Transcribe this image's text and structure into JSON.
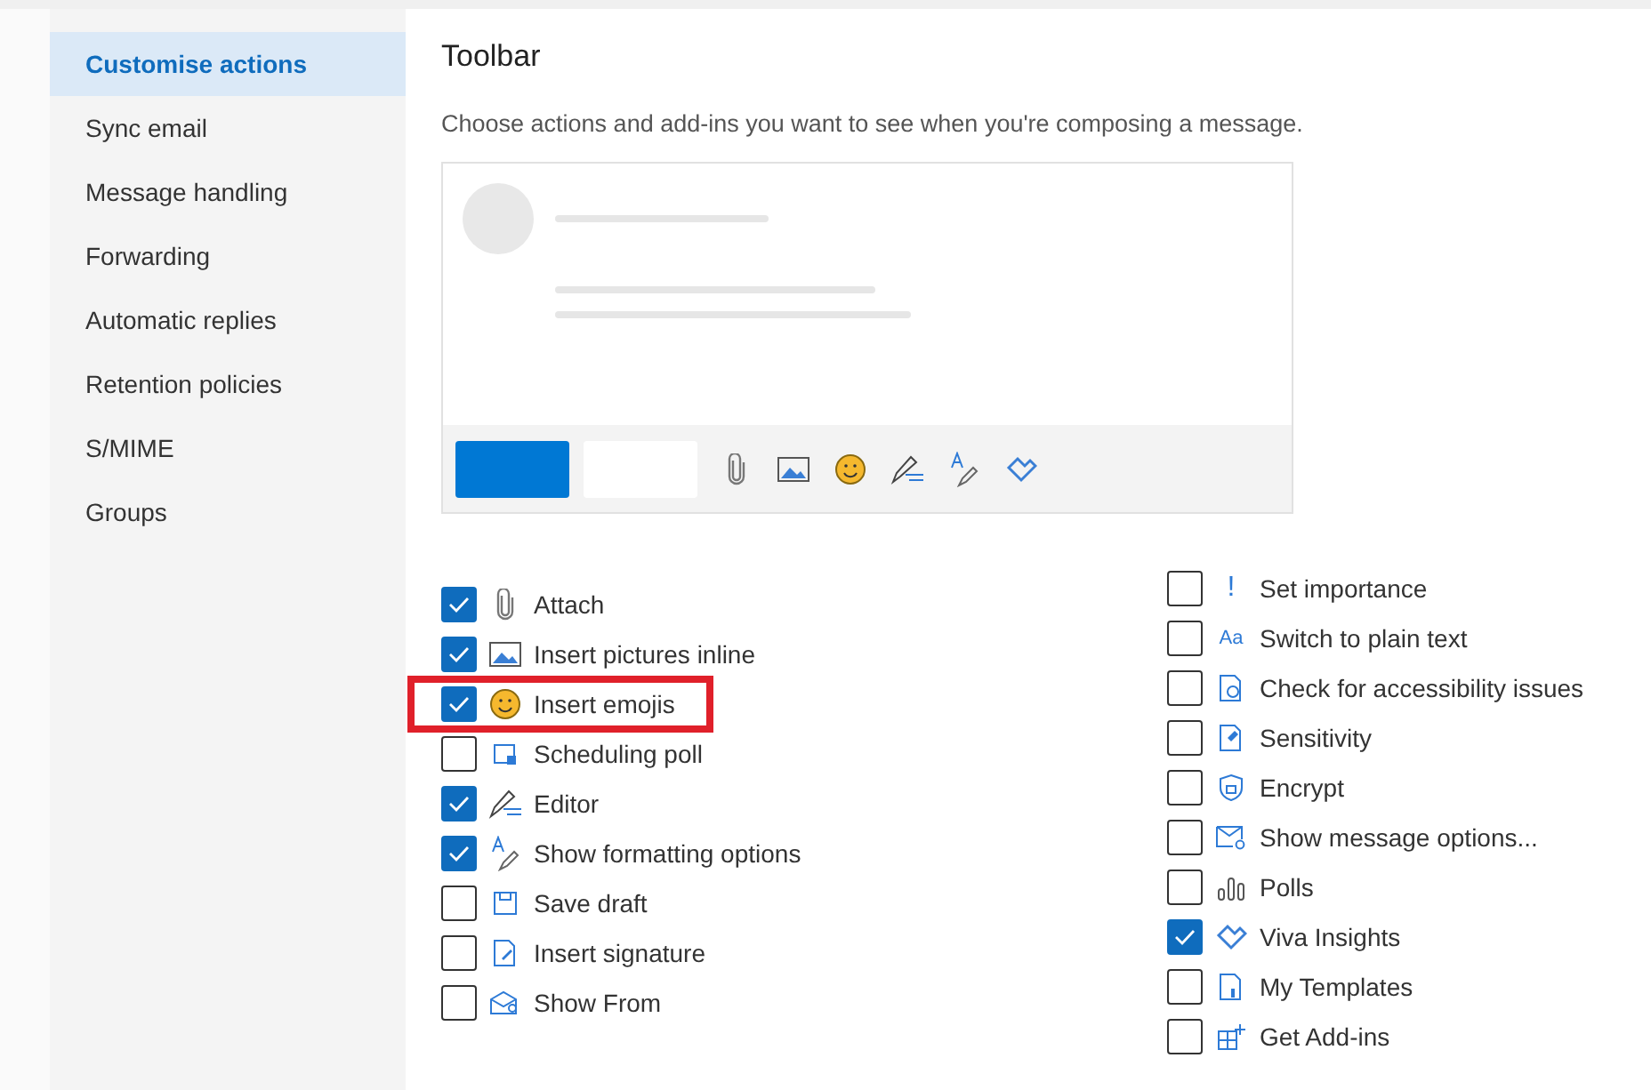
{
  "sidebar": {
    "items": [
      {
        "label": "Customise actions",
        "selected": true
      },
      {
        "label": "Sync email",
        "selected": false
      },
      {
        "label": "Message handling",
        "selected": false
      },
      {
        "label": "Forwarding",
        "selected": false
      },
      {
        "label": "Automatic replies",
        "selected": false
      },
      {
        "label": "Retention policies",
        "selected": false
      },
      {
        "label": "S/MIME",
        "selected": false
      },
      {
        "label": "Groups",
        "selected": false
      }
    ]
  },
  "section": {
    "title": "Toolbar",
    "description": "Choose actions and add-ins you want to see when you're composing a message."
  },
  "options": {
    "column_1": [
      {
        "label": "Attach",
        "kind": "attach",
        "checked": true,
        "highlighted": false
      },
      {
        "label": "Insert pictures inline",
        "kind": "picture",
        "checked": true,
        "highlighted": false
      },
      {
        "label": "Insert emojis",
        "kind": "emoji",
        "checked": true,
        "highlighted": true
      },
      {
        "label": "Scheduling poll",
        "kind": "poll",
        "checked": false,
        "highlighted": false
      },
      {
        "label": "Editor",
        "kind": "editor",
        "checked": true,
        "highlighted": false
      },
      {
        "label": "Show formatting options",
        "kind": "format",
        "checked": true,
        "highlighted": false
      },
      {
        "label": "Save draft",
        "kind": "save",
        "checked": false,
        "highlighted": false
      },
      {
        "label": "Insert signature",
        "kind": "signature",
        "checked": false,
        "highlighted": false
      },
      {
        "label": "Show From",
        "kind": "from",
        "checked": false,
        "highlighted": false
      }
    ],
    "column_2": [
      {
        "glyph": "!",
        "kind": "importance",
        "checked": false,
        "highlighted": false,
        "label": "Set importance"
      },
      {
        "glyph": "Aa",
        "kind": "plaintext",
        "checked": false,
        "highlighted": false,
        "label": "Switch to plain text"
      },
      {
        "kind": "accessibility",
        "checked": false,
        "highlighted": false,
        "label": "Check for accessibility issues"
      },
      {
        "kind": "sensitivity",
        "checked": false,
        "highlighted": false,
        "label": "Sensitivity"
      },
      {
        "kind": "encrypt",
        "checked": false,
        "highlighted": false,
        "label": "Encrypt"
      },
      {
        "kind": "msgoptions",
        "checked": false,
        "highlighted": false,
        "label": "Show message options..."
      },
      {
        "kind": "polls",
        "checked": false,
        "highlighted": false,
        "label": "Polls"
      },
      {
        "kind": "viva",
        "checked": true,
        "highlighted": false,
        "label": "Viva Insights"
      },
      {
        "kind": "templates",
        "checked": false,
        "highlighted": false,
        "label": "My Templates"
      },
      {
        "kind": "addins",
        "checked": false,
        "highlighted": false,
        "label": "Get Add-ins"
      }
    ]
  }
}
